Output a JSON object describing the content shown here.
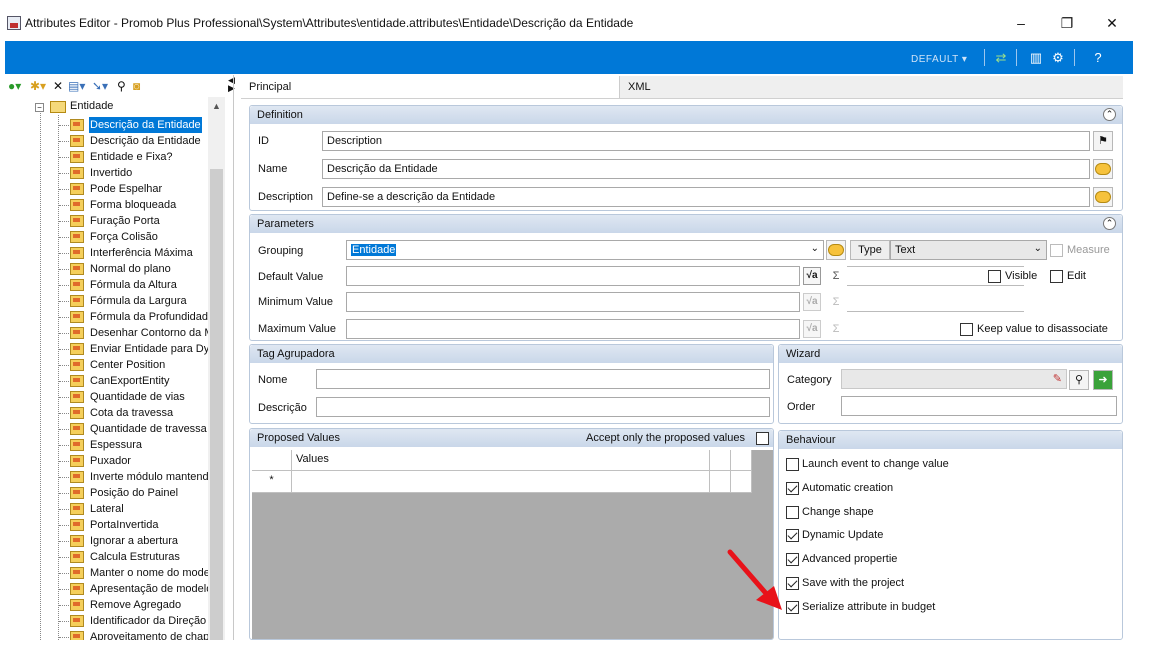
{
  "window": {
    "title": "Attributes Editor - Promob Plus Professional\\System\\Attributes\\entidade.attributes\\Entidade\\Descrição da Entidade",
    "min": "–",
    "max": "❐",
    "close": "✕"
  },
  "toolbar": {
    "default_label": "DEFAULT ▾",
    "accent": "#0078d7"
  },
  "tree": {
    "root": "Entidade",
    "items": [
      "Descrição da Entidade",
      "Descrição da Entidade",
      "Entidade e Fixa?",
      "Invertido",
      "Pode Espelhar",
      "Forma bloqueada",
      "Furação Porta",
      "Força Colisão",
      "Interferência Máxima",
      "Normal do plano",
      "Fórmula da Altura",
      "Fórmula da Largura",
      "Fórmula da Profundidade",
      "Desenhar Contorno da M",
      "Enviar Entidade para Dy",
      "Center Position",
      "CanExportEntity",
      "Quantidade de vias",
      "Cota da travessa",
      "Quantidade de travessa",
      "Espessura",
      "Puxador",
      "Inverte módulo mantend",
      "Posição do Painel",
      "Lateral",
      "PortaInvertida",
      "Ignorar a abertura",
      "Calcula Estruturas",
      "Manter o nome do mode",
      "Apresentação de modelo",
      "Remove Agregado",
      "Identificador da Direção",
      "Aproveitamento de chap"
    ]
  },
  "tabs": {
    "principal": "Principal",
    "xml": "XML"
  },
  "definition": {
    "title": "Definition",
    "id_label": "ID",
    "id_value": "Description",
    "name_label": "Name",
    "name_value": "Descrição da Entidade",
    "description_label": "Description",
    "description_value": "Define-se a descrição da Entidade"
  },
  "parameters": {
    "title": "Parameters",
    "grouping_label": "Grouping",
    "grouping_value": "Entidade",
    "type_label": "Type",
    "type_value": "Text",
    "measure_label": "Measure",
    "default_label": "Default Value",
    "minimum_label": "Minimum Value",
    "maximum_label": "Maximum Value",
    "visible_label": "Visible",
    "edit_label": "Edit",
    "keep_label": "Keep value to disassociate",
    "sigma": "Σ"
  },
  "tag_agrupadora": {
    "title": "Tag Agrupadora",
    "nome_label": "Nome",
    "descricao_label": "Descrição"
  },
  "wizard": {
    "title": "Wizard",
    "category_label": "Category",
    "order_label": "Order"
  },
  "proposed_values": {
    "title": "Proposed Values",
    "accept_label": "Accept only the proposed values",
    "column": "Values",
    "new_row_marker": "*"
  },
  "behaviour": {
    "title": "Behaviour",
    "items": [
      {
        "label": "Launch event to change value",
        "checked": false
      },
      {
        "label": "Automatic creation",
        "checked": true
      },
      {
        "label": "Change shape",
        "checked": false
      },
      {
        "label": "Dynamic Update",
        "checked": true
      },
      {
        "label": "Advanced propertie",
        "checked": true
      },
      {
        "label": "Save with the project",
        "checked": true
      },
      {
        "label": "Serialize attribute in budget",
        "checked": true
      }
    ]
  }
}
